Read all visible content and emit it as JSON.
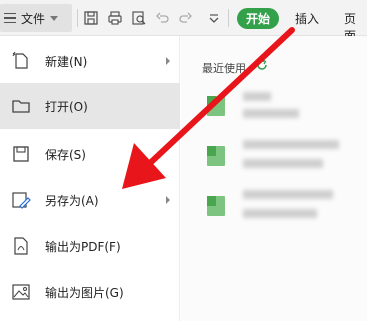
{
  "toolbar": {
    "file_label": "文件",
    "tabs": {
      "start": "开始",
      "insert": "插入",
      "page": "页面"
    }
  },
  "menu": {
    "items": [
      {
        "label": "新建(N)",
        "icon": "new-file-icon",
        "has_submenu": true
      },
      {
        "label": "打开(O)",
        "icon": "folder-icon",
        "active": true
      },
      {
        "label": "保存(S)",
        "icon": "save-icon"
      },
      {
        "label": "另存为(A)",
        "icon": "save-as-icon",
        "has_submenu": true
      },
      {
        "label": "输出为PDF(F)",
        "icon": "pdf-icon"
      },
      {
        "label": "输出为图片(G)",
        "icon": "image-icon"
      }
    ]
  },
  "recent": {
    "title": "最近使用",
    "icon": "refresh-icon"
  },
  "colors": {
    "accent": "#33a04a",
    "arrow": "#e8151b",
    "active_row": "#e6e6e6"
  }
}
